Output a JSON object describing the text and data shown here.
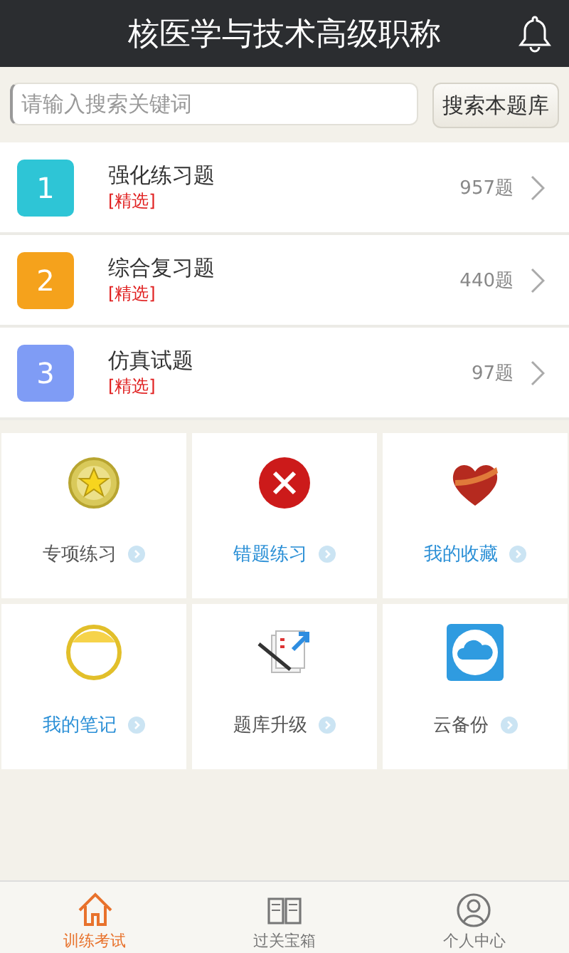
{
  "header": {
    "title": "核医学与技术高级职称"
  },
  "search": {
    "placeholder": "请输入搜索关键词",
    "button": "搜索本题库"
  },
  "exams": [
    {
      "number": "1",
      "title": "强化练习题",
      "tag": "[精选]",
      "count": "957题",
      "color": "#2ec5d6"
    },
    {
      "number": "2",
      "title": "综合复习题",
      "tag": "[精选]",
      "count": "440题",
      "color": "#f5a21c"
    },
    {
      "number": "3",
      "title": "仿真试题",
      "tag": "[精选]",
      "count": "97题",
      "color": "#7f9cf5"
    }
  ],
  "features": [
    {
      "label": "专项练习",
      "highlighted": false
    },
    {
      "label": "错题练习",
      "highlighted": true
    },
    {
      "label": "我的收藏",
      "highlighted": true
    },
    {
      "label": "我的笔记",
      "highlighted": true
    },
    {
      "label": "题库升级",
      "highlighted": false
    },
    {
      "label": "云备份",
      "highlighted": false
    }
  ],
  "tabs": [
    {
      "label": "训练考试",
      "selected": true
    },
    {
      "label": "过关宝箱",
      "selected": false
    },
    {
      "label": "个人中心",
      "selected": false
    }
  ]
}
